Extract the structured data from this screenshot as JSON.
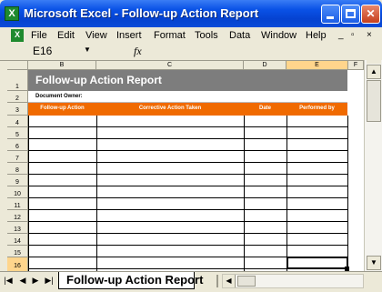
{
  "window": {
    "app_icon": "excel-icon",
    "title": "Microsoft Excel - Follow-up Action Report",
    "minimize_label": "",
    "maximize_label": "",
    "close_label": "✕"
  },
  "menu": {
    "items": [
      "File",
      "Edit",
      "View",
      "Insert",
      "Format",
      "Tools",
      "Data",
      "Window",
      "Help"
    ],
    "mdi_minimize": "_",
    "mdi_restore": "▫",
    "mdi_close": "×"
  },
  "formula_bar": {
    "name_box": "E16",
    "fx": "fx",
    "value": ""
  },
  "sheet": {
    "columns": [
      "A",
      "B",
      "C",
      "D",
      "E",
      "F"
    ],
    "selected_column": "E",
    "rows": [
      "1",
      "2",
      "3",
      "4",
      "5",
      "6",
      "7",
      "8",
      "9",
      "10",
      "11",
      "12",
      "13",
      "14",
      "15",
      "16"
    ],
    "selected_row": "16",
    "banner_title": "Follow-up Action Report",
    "document_owner_label": "Document Owner:",
    "headers": [
      "Follow-up Action",
      "Corrective Action Taken",
      "Date",
      "Performed by"
    ],
    "header_color": "#f06a00",
    "banner_color": "#7d7d7d"
  },
  "tabs": {
    "nav": [
      "|◀",
      "◀",
      "▶",
      "▶|"
    ],
    "active_sheet": "Follow-up Action Report"
  }
}
